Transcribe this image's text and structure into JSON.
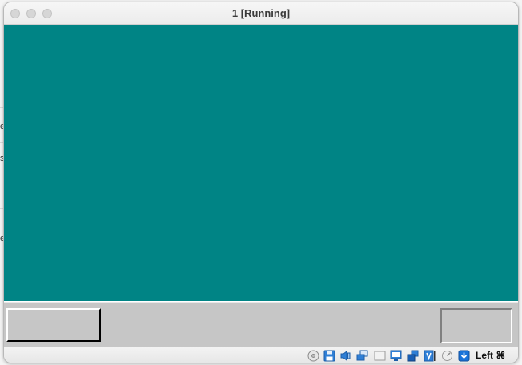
{
  "window": {
    "title": "1 [Running]"
  },
  "background_app": {
    "glyphs": [
      "e",
      "s",
      "e"
    ]
  },
  "statusbar": {
    "icons": [
      "optical-drive-icon",
      "floppy-disk-icon",
      "audio-icon",
      "network-icon",
      "usb-icon",
      "display-icon",
      "shared-folders-icon",
      "virtualization-icon",
      "mouse-integration-icon",
      "keyboard-capture-icon"
    ],
    "host_key_label": "Left ⌘"
  },
  "colors": {
    "guest_desktop": "#008485",
    "taskbar": "#c6c6c6",
    "accent_blue": "#1a73d9"
  }
}
